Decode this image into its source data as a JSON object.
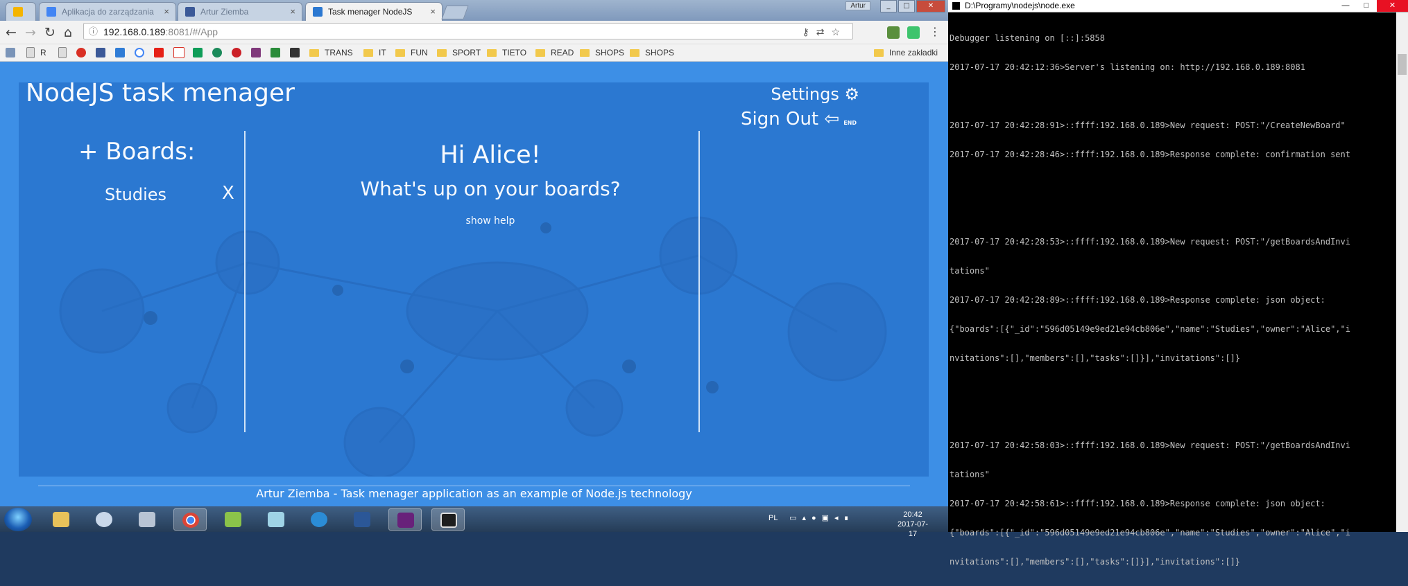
{
  "browser": {
    "tabs": [
      {
        "label": "",
        "icon": "google-drive-icon",
        "color": "#f4b400"
      },
      {
        "label": "Aplikacja do zarządzania",
        "icon": "docs-icon",
        "color": "#4285f4"
      },
      {
        "label": "Artur Ziemba",
        "icon": "facebook-icon",
        "color": "#3b5998"
      },
      {
        "label": "Task menager NodeJS",
        "icon": "app-icon",
        "color": "#2b78d1"
      }
    ],
    "profile": "Artur",
    "url_host": "192.168.0.189",
    "url_rest": ":8081/#/App",
    "bookmarks": [
      {
        "label": "R",
        "icon": "page-icon"
      },
      {
        "label": "TRANS",
        "icon": "folder-icon"
      },
      {
        "label": "IT",
        "icon": "folder-icon"
      },
      {
        "label": "FUN",
        "icon": "folder-icon"
      },
      {
        "label": "SPORT",
        "icon": "folder-icon"
      },
      {
        "label": "TIETO",
        "icon": "folder-icon"
      },
      {
        "label": "READ",
        "icon": "folder-icon"
      },
      {
        "label": "SHOPS",
        "icon": "folder-icon"
      },
      {
        "label": "SHOPS",
        "icon": "folder-icon"
      }
    ],
    "other_bookmarks": "Inne zakładki"
  },
  "app": {
    "title": "NodeJS task menager",
    "settings": "Settings ⚙",
    "sign_out": "Sign Out ⇦",
    "sign_out_key": "END",
    "boards_heading": "+ Boards:",
    "boards": [
      {
        "name": "Studies",
        "remove": "X"
      }
    ],
    "greeting": "Hi Alice!",
    "subtitle": "What's up on your boards?",
    "help": "show help",
    "footer": "Artur Ziemba - Task menager application as an example of Node.js technology",
    "colors": {
      "page": "#3d8fe6",
      "panel": "#2b78d1",
      "text": "#ffffff"
    }
  },
  "taskbar": {
    "lang": "PL",
    "time": "20:42",
    "date": "2017-07-17"
  },
  "console": {
    "title": "D:\\Programy\\nodejs\\node.exe",
    "lines": [
      "Debugger listening on [::]:5858",
      "2017-07-17 20:42:12:36>Server's listening on: http://192.168.0.189:8081",
      "",
      "2017-07-17 20:42:28:91>::ffff:192.168.0.189>New request: POST:\"/CreateNewBoard\"",
      "2017-07-17 20:42:28:46>::ffff:192.168.0.189>Response complete: confirmation sent",
      "",
      "",
      "2017-07-17 20:42:28:53>::ffff:192.168.0.189>New request: POST:\"/getBoardsAndInvi",
      "tations\"",
      "2017-07-17 20:42:28:89>::ffff:192.168.0.189>Response complete: json object:",
      "{\"boards\":[{\"_id\":\"596d05149e9ed21e94cb806e\",\"name\":\"Studies\",\"owner\":\"Alice\",\"i",
      "nvitations\":[],\"members\":[],\"tasks\":[]}],\"invitations\":[]}",
      "",
      "",
      "2017-07-17 20:42:58:03>::ffff:192.168.0.189>New request: POST:\"/getBoardsAndInvi",
      "tations\"",
      "2017-07-17 20:42:58:61>::ffff:192.168.0.189>Response complete: json object:",
      "{\"boards\":[{\"_id\":\"596d05149e9ed21e94cb806e\",\"name\":\"Studies\",\"owner\":\"Alice\",\"i",
      "nvitations\":[],\"members\":[],\"tasks\":[]}],\"invitations\":[]}"
    ]
  }
}
